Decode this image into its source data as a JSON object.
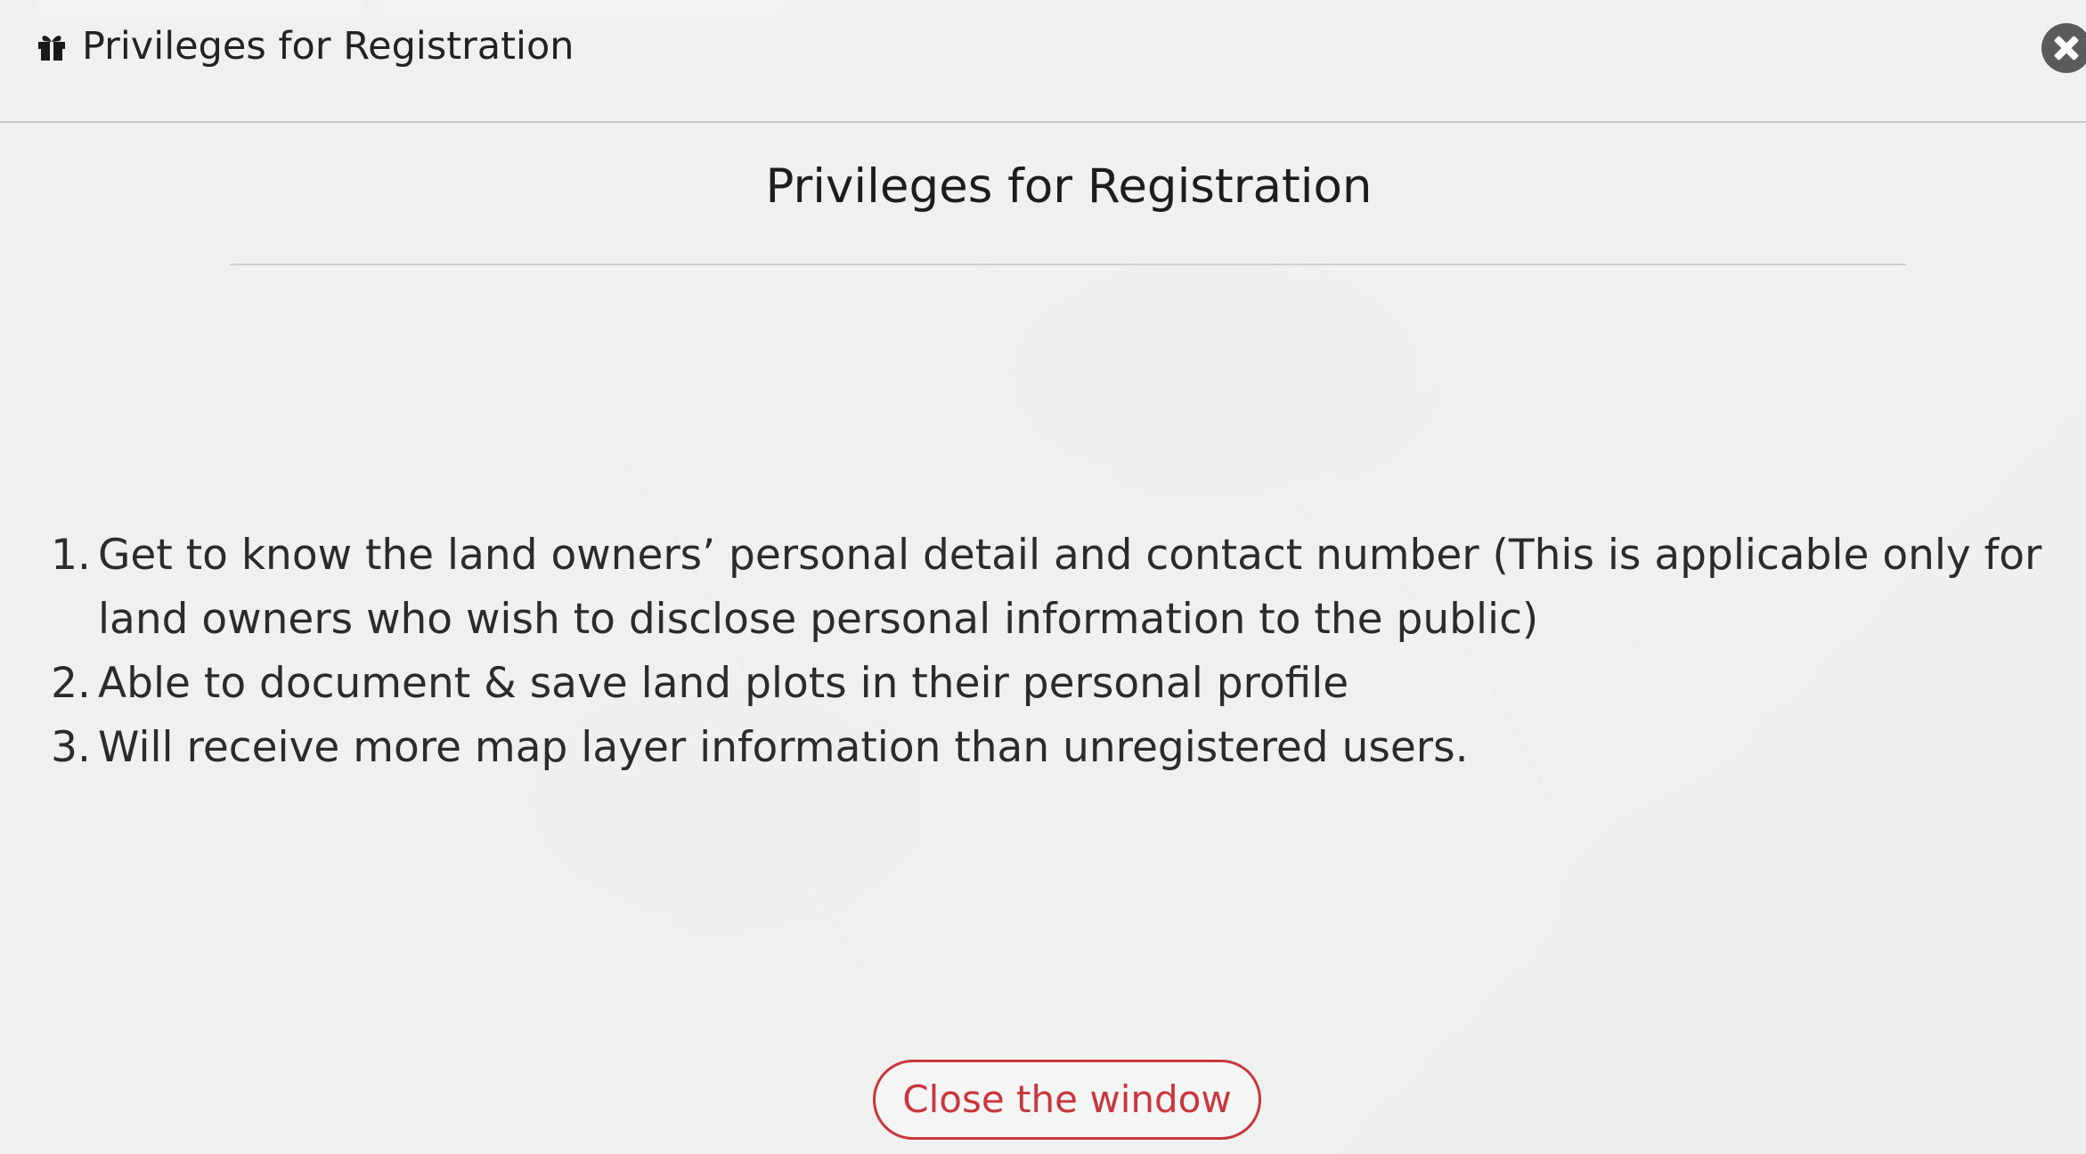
{
  "header": {
    "icon": "gift-icon",
    "title": "Privileges for Registration"
  },
  "content": {
    "title": "Privileges for Registration",
    "items": [
      {
        "number": "1.",
        "text": "Get to know the land owners’ personal detail and contact number (This is applicable only for land owners who wish to disclose personal information to the public)"
      },
      {
        "number": "2.",
        "text": "Able to document & save land plots in their personal profile"
      },
      {
        "number": "3.",
        "text": "Will receive more map layer information than unregistered users."
      }
    ]
  },
  "footer": {
    "close_label": "Close the window"
  },
  "colors": {
    "accent_red": "#c9363c",
    "overlay": "#f2f2f2",
    "text": "#2b2b2b"
  }
}
